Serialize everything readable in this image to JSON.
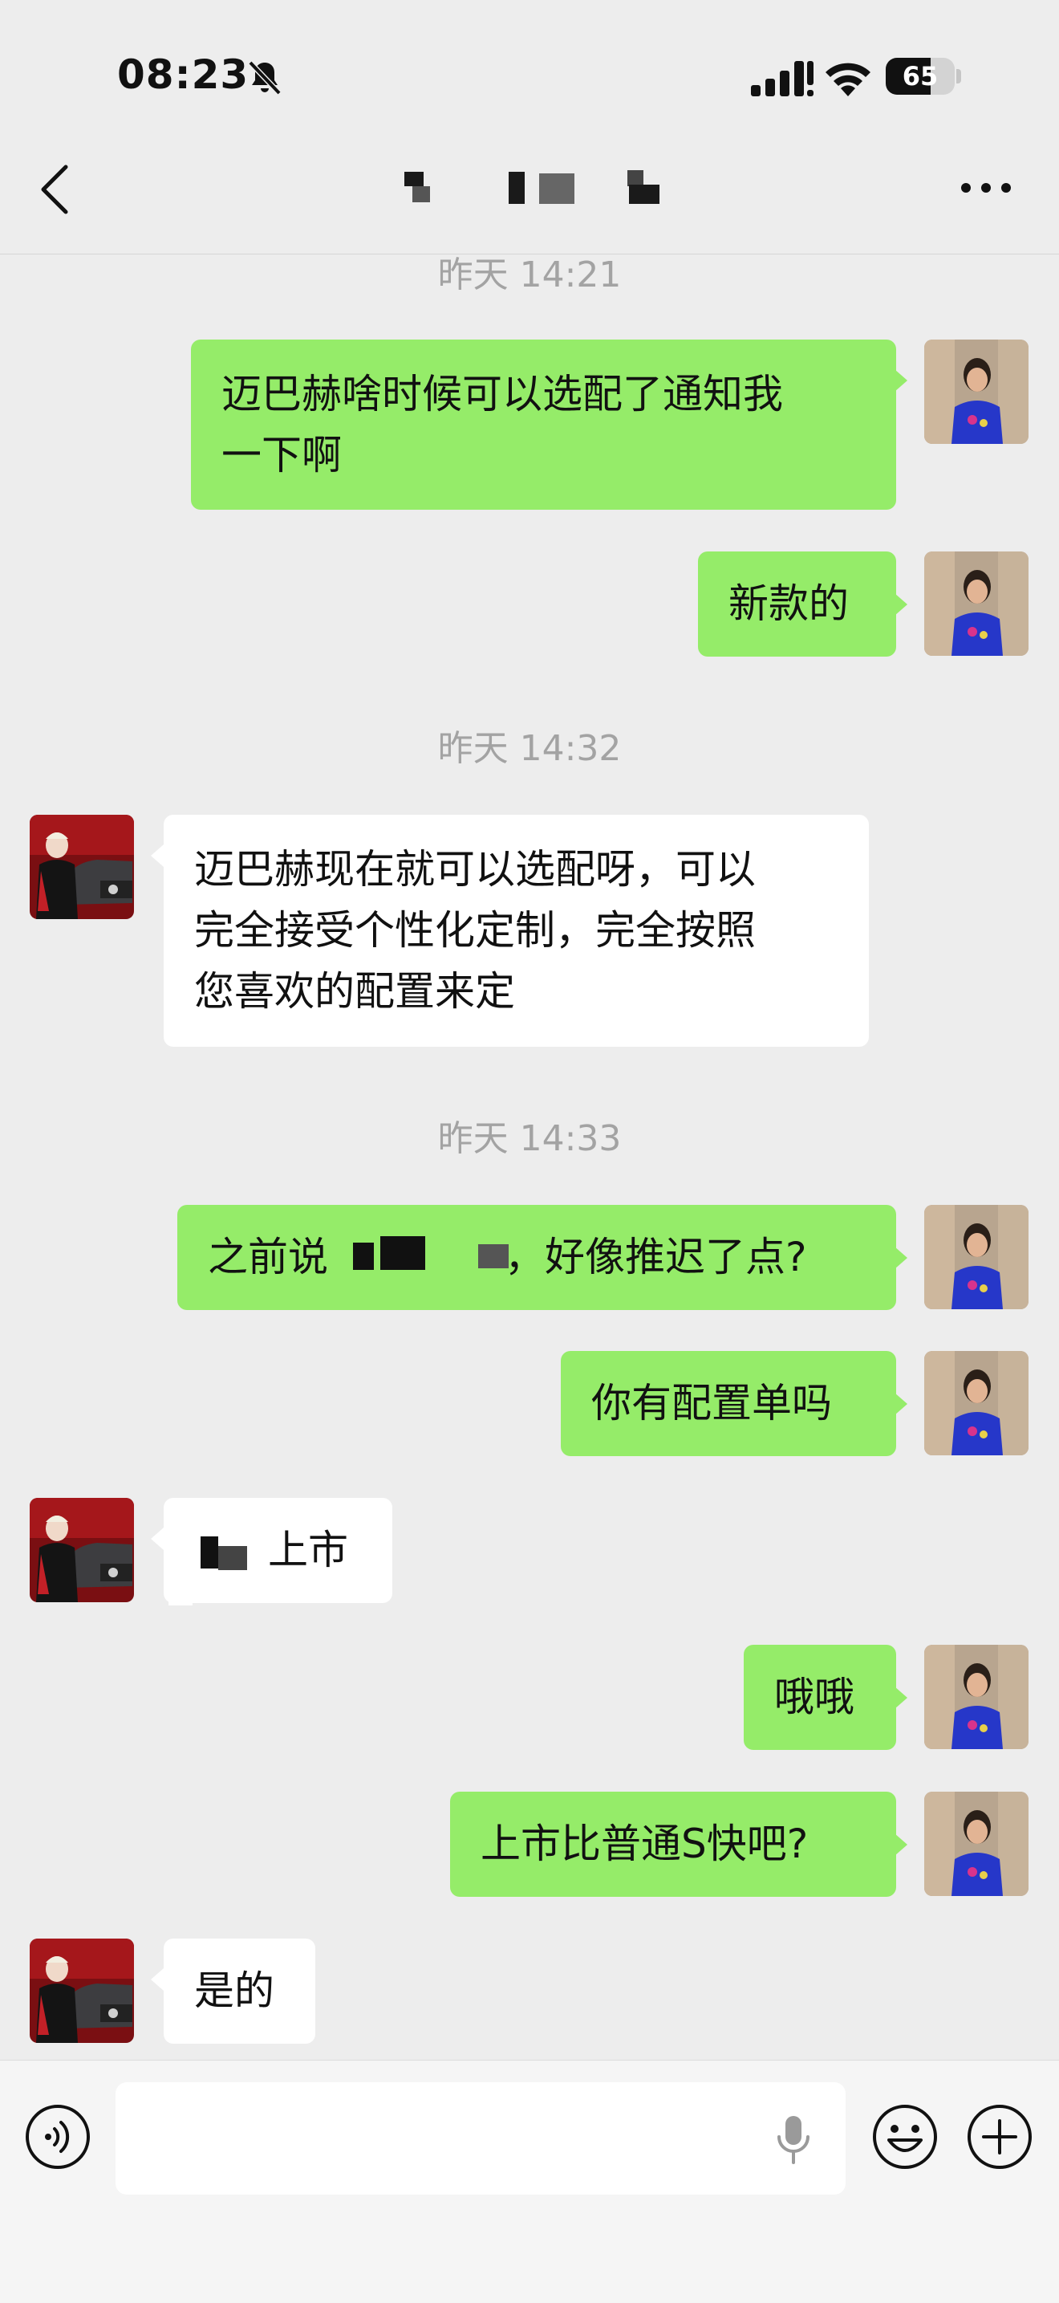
{
  "status_bar": {
    "time": "08:23",
    "battery": "65",
    "battery_level": 0.65
  },
  "nav": {
    "back_icon": "chevron-left-icon",
    "more_icon": "ellipsis-icon"
  },
  "messages": [
    {
      "type": "timestamp",
      "text": "昨天 14:21"
    },
    {
      "type": "outgoing",
      "text": "迈巴赫啥时候可以选配了通知我\n一下啊"
    },
    {
      "type": "outgoing",
      "text": "新款的"
    },
    {
      "type": "timestamp",
      "text": "昨天 14:32"
    },
    {
      "type": "incoming",
      "text": "迈巴赫现在就可以选配呀，可以\n完全接受个性化定制，完全按照\n您喜欢的配置来定"
    },
    {
      "type": "timestamp",
      "text": "昨天 14:33"
    },
    {
      "type": "outgoing",
      "text_prefix": "之前说",
      "text_suffix": "，好像推迟了点?"
    },
    {
      "type": "outgoing",
      "text": "你有配置单吗"
    },
    {
      "type": "incoming",
      "text": "上市"
    },
    {
      "type": "outgoing",
      "text": "哦哦"
    },
    {
      "type": "outgoing",
      "text": "上市比普通S快吧?"
    },
    {
      "type": "incoming",
      "text": "是的"
    }
  ],
  "input_bar": {
    "voice_icon": "voice-icon",
    "mic_icon": "microphone-icon",
    "emoji_icon": "emoji-icon",
    "plus_icon": "plus-icon"
  },
  "colors": {
    "outgoing_bubble": "#95ec69",
    "incoming_bubble": "#ffffff",
    "background": "#ededed"
  }
}
